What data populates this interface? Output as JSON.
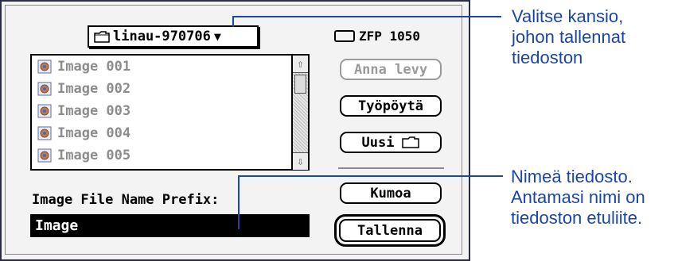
{
  "dialog": {
    "folder_popup": {
      "label": "linau-970706",
      "icon": "folder-icon"
    },
    "disk": {
      "label": "ZFP 1050",
      "icon": "disk-icon"
    },
    "files": [
      {
        "name": "Image 001",
        "icon": "image-file-icon"
      },
      {
        "name": "Image 002",
        "icon": "image-file-icon"
      },
      {
        "name": "Image 003",
        "icon": "image-file-icon"
      },
      {
        "name": "Image 004",
        "icon": "image-file-icon"
      },
      {
        "name": "Image 005",
        "icon": "image-file-icon"
      }
    ],
    "buttons": {
      "eject": "Anna levy",
      "desktop": "Työpöytä",
      "new_folder": "Uusi",
      "cancel": "Kumoa",
      "save": "Tallenna"
    },
    "prefix_label": "Image File Name Prefix:",
    "prefix_value": "Image"
  },
  "annotations": {
    "folder": [
      "Valitse kansio,",
      "johon tallennat",
      "tiedoston"
    ],
    "name": [
      "Nimeä tiedosto.",
      "Antamasi nimi on",
      "tiedoston etuliite."
    ]
  },
  "colors": {
    "annotation": "#1946a8",
    "dialog_bg": "#f3f3f3"
  }
}
